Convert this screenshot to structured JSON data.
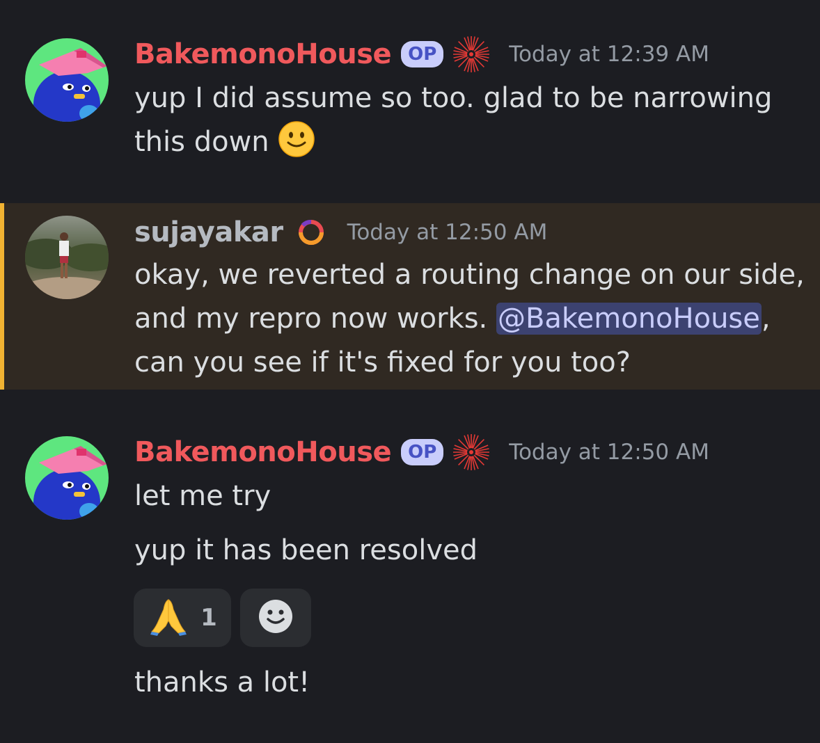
{
  "messages": [
    {
      "username": "BakemonoHouse",
      "badge": "OP",
      "timestamp": "Today at 12:39 AM",
      "lines": [
        "yup I did assume so too. glad to be narrowing",
        "this down"
      ],
      "emoji": "slightly-smiling-face",
      "name_color": "#f0595c"
    },
    {
      "username": "sujayakar",
      "timestamp": "Today at 12:50 AM",
      "line1": "okay, we reverted a routing change on our side,",
      "line2_before": "and my repro now works. ",
      "mention": "@BakemonoHouse",
      "line2_after": ",",
      "line3": "can you see if it's fixed for you too?",
      "highlight_color": "#f0b232"
    },
    {
      "username": "BakemonoHouse",
      "badge": "OP",
      "timestamp": "Today at 12:50 AM",
      "line1": "let me try",
      "line2": "yup it has been resolved",
      "reaction": {
        "emoji": "folded-hands",
        "count": "1"
      },
      "add_reaction_icon": "smiley-add-reaction-icon",
      "line3": "thanks a lot!"
    }
  ]
}
